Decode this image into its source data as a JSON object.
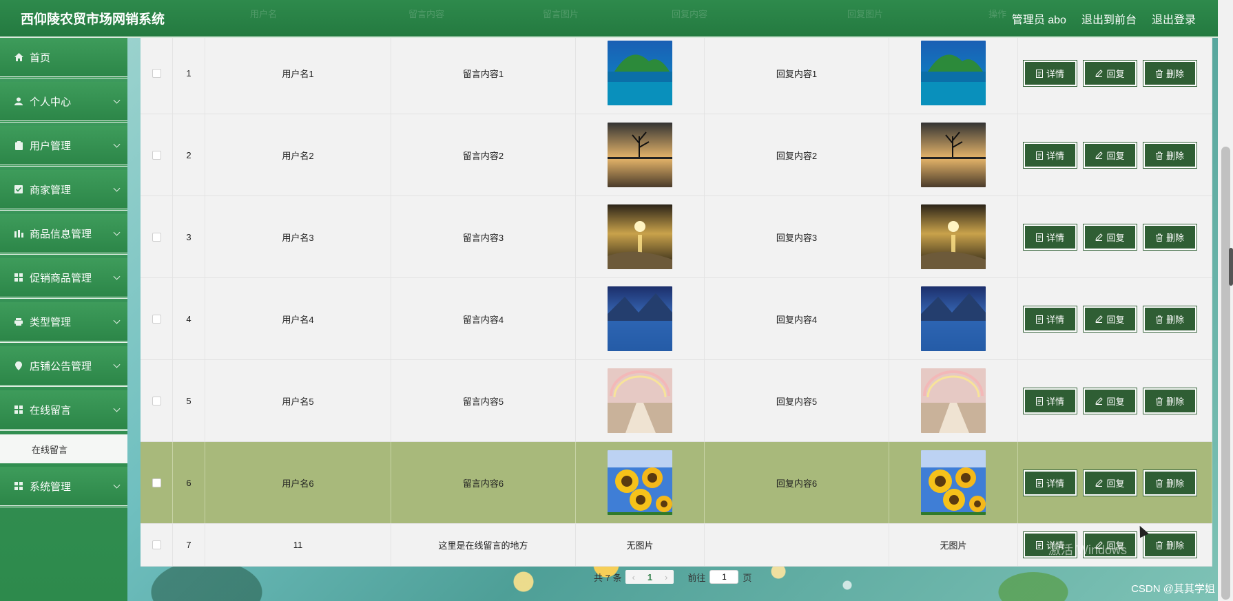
{
  "header": {
    "title": "西仰陵农贸市场网销系统",
    "user_label": "管理员 abo",
    "to_front_label": "退出到前台",
    "logout_label": "退出登录",
    "ghost_columns": [
      "用户名",
      "留言内容",
      "留言图片",
      "回复内容",
      "回复图片",
      "操作"
    ]
  },
  "sidebar": {
    "items": [
      {
        "label": "首页",
        "icon": "home-icon"
      },
      {
        "label": "个人中心",
        "icon": "user-icon"
      },
      {
        "label": "用户管理",
        "icon": "clipboard-icon"
      },
      {
        "label": "商家管理",
        "icon": "checkbox-icon"
      },
      {
        "label": "商品信息管理",
        "icon": "bars-icon"
      },
      {
        "label": "促销商品管理",
        "icon": "grid-icon"
      },
      {
        "label": "类型管理",
        "icon": "printer-icon"
      },
      {
        "label": "店铺公告管理",
        "icon": "pin-icon"
      },
      {
        "label": "在线留言",
        "icon": "grid-icon"
      },
      {
        "label": "系统管理",
        "icon": "grid-icon"
      }
    ],
    "submenu_label": "在线留言"
  },
  "table": {
    "rows": [
      {
        "index": "1",
        "username": "用户名1",
        "content": "留言内容1",
        "image": "landscape-island",
        "reply": "回复内容1",
        "reply_image": "landscape-island"
      },
      {
        "index": "2",
        "username": "用户名2",
        "content": "留言内容2",
        "image": "landscape-tree",
        "reply": "回复内容2",
        "reply_image": "landscape-tree"
      },
      {
        "index": "3",
        "username": "用户名3",
        "content": "留言内容3",
        "image": "landscape-sunset",
        "reply": "回复内容3",
        "reply_image": "landscape-sunset"
      },
      {
        "index": "4",
        "username": "用户名4",
        "content": "留言内容4",
        "image": "landscape-lake",
        "reply": "回复内容4",
        "reply_image": "landscape-lake"
      },
      {
        "index": "5",
        "username": "用户名5",
        "content": "留言内容5",
        "image": "landscape-rainbow",
        "reply": "回复内容5",
        "reply_image": "landscape-rainbow"
      },
      {
        "index": "6",
        "username": "用户名6",
        "content": "留言内容6",
        "image": "sunflowers",
        "reply": "回复内容6",
        "reply_image": "sunflowers"
      },
      {
        "index": "7",
        "username": "11",
        "content": "这里是在线留言的地方",
        "image_text": "无图片",
        "reply": "",
        "reply_image_text": "无图片"
      }
    ],
    "actions": {
      "detail": "详情",
      "reply": "回复",
      "delete": "删除"
    }
  },
  "pager": {
    "total": "共 7 条",
    "current": "1",
    "goto_label": "前往",
    "goto_value": "1",
    "page_suffix": "页"
  },
  "overlay": {
    "watermark": "CSDN @其其学姐",
    "activate_windows": "激活 Windows"
  },
  "colors": {
    "header_green": "#2e8a4c",
    "button_green": "#2f5e34",
    "highlight_row": "#a8b97b"
  }
}
